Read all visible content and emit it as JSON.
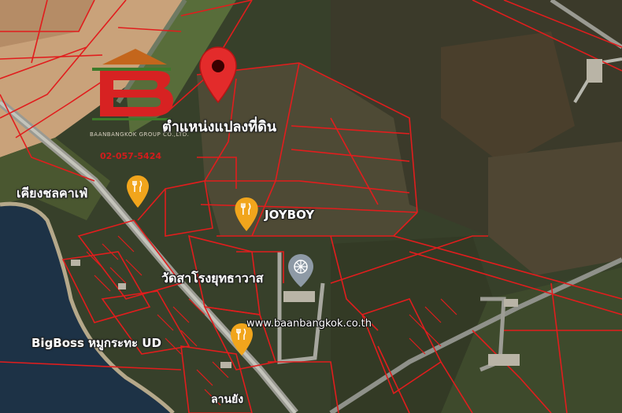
{
  "map": {
    "labels": {
      "land_position": "ตำแหน่งแปลงที่ดิน",
      "restaurant_west": "เคียงชลคาเฟ่",
      "joyboy": "JOYBOY",
      "temple": "วัดสาโรงยุทธาวาส",
      "bigboss": "BigBoss หมูกระทะ UD",
      "bottom_partial": "ลานยัง"
    }
  },
  "watermark": {
    "company": "BAANBANGKOK GROUP CO.,LTD.",
    "phone": "02-057-5424",
    "website": "www.baanbangkok.co.th"
  },
  "colors": {
    "parcel_line": "#e11d1d",
    "pin_red": "#e32b2b",
    "poi_orange": "#f1a51c",
    "temple_gray": "#8e9aa6",
    "water": "#1d3246"
  }
}
